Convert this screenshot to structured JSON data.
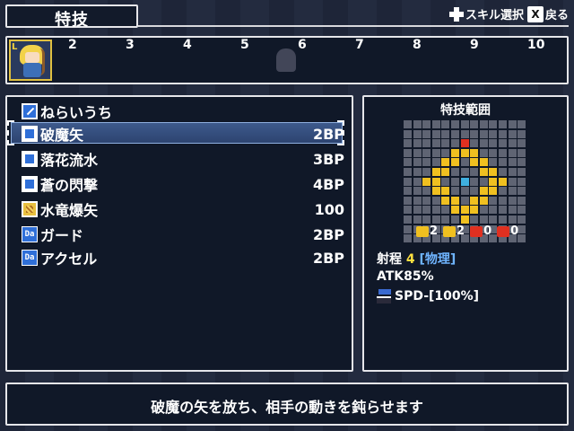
{
  "header": {
    "title": "特技",
    "hints": [
      {
        "icon": "dpad-icon",
        "label": "スキル選択"
      },
      {
        "icon": "x-button-icon",
        "button": "X",
        "label": "戻る"
      }
    ]
  },
  "party": {
    "leader_badge": "L",
    "slots": [
      "2",
      "3",
      "4",
      "5",
      "6",
      "7",
      "8",
      "9",
      "10"
    ]
  },
  "skills": {
    "category": {
      "name": "ねらいうち",
      "icon": "sword-icon"
    },
    "items": [
      {
        "name": "破魔矢",
        "cost": "2BP",
        "icon": "blue-skill-icon",
        "selected": true
      },
      {
        "name": "落花流水",
        "cost": "3BP",
        "icon": "blue-skill-icon"
      },
      {
        "name": "蒼の閃撃",
        "cost": "4BP",
        "icon": "blue-skill-icon"
      },
      {
        "name": "水竜爆矢",
        "cost": "100",
        "icon": "gold-skill-icon"
      },
      {
        "name": "ガード",
        "cost": "2BP",
        "icon": "da-icon",
        "icon_text": "Da"
      },
      {
        "name": "アクセル",
        "cost": "2BP",
        "icon": "da-icon",
        "icon_text": "Da"
      }
    ]
  },
  "range": {
    "title": "特技範囲",
    "elements": [
      {
        "icon": "yellow-up-icon",
        "value": "2",
        "color": "#f0c020"
      },
      {
        "icon": "yellow-down-icon",
        "value": "2",
        "color": "#f0c020"
      },
      {
        "icon": "red-up-icon",
        "value": "0",
        "color": "#e03020"
      },
      {
        "icon": "red-down-icon",
        "value": "0",
        "color": "#e03020"
      }
    ],
    "range_label": "射程",
    "range_value": "4",
    "range_type": "[物理]",
    "atk": "ATK85%",
    "spd": "SPD-[100%]"
  },
  "description": "破魔の矢を放ち、相手の動きを鈍らせます",
  "colors": {
    "panel_bg": "#101828",
    "border": "#e6e6ea",
    "target_cell": "#f0c020",
    "origin_cell": "#3fb0e0",
    "selection": "#3d5a8c"
  }
}
